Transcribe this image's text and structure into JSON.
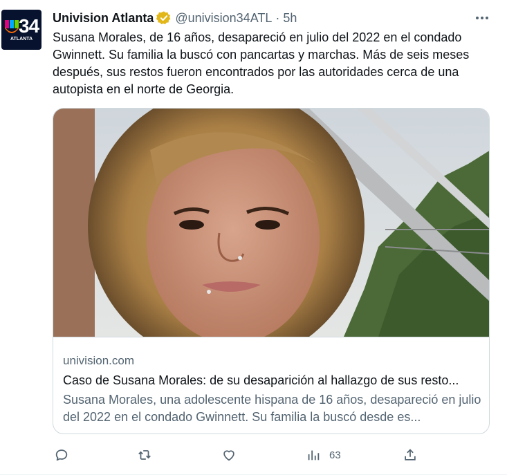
{
  "author": {
    "name": "Univision Atlanta",
    "handle": "@univision34ATL",
    "separator": "·",
    "time": "5h",
    "avatar_number": "34",
    "avatar_city": "ATLANTA"
  },
  "tweet": {
    "text": "Susana Morales, de 16 años, desapareció en julio del 2022 en el condado Gwinnett. Su familia la buscó con pancartas y marchas. Más de seis meses después, sus restos fueron encontrados por las autoridades cerca de una autopista en el norte de Georgia."
  },
  "card": {
    "domain": "univision.com",
    "title": "Caso de Susana Morales: de su desaparición al hallazgo de sus resto...",
    "description": "Susana Morales, una adolescente hispana de 16 años, desapareció en julio del 2022 en el condado Gwinnett. Su familia la buscó desde es..."
  },
  "actions": {
    "views": "63"
  },
  "icons": {
    "verified": "verified-badge-icon",
    "more": "more-icon",
    "reply": "reply-icon",
    "retweet": "retweet-icon",
    "like": "heart-icon",
    "views": "views-chart-icon",
    "share": "share-icon"
  },
  "colors": {
    "text": "#0f1419",
    "secondary": "#536471",
    "border": "#cfd9de",
    "verified_gold": "#e2b719"
  }
}
